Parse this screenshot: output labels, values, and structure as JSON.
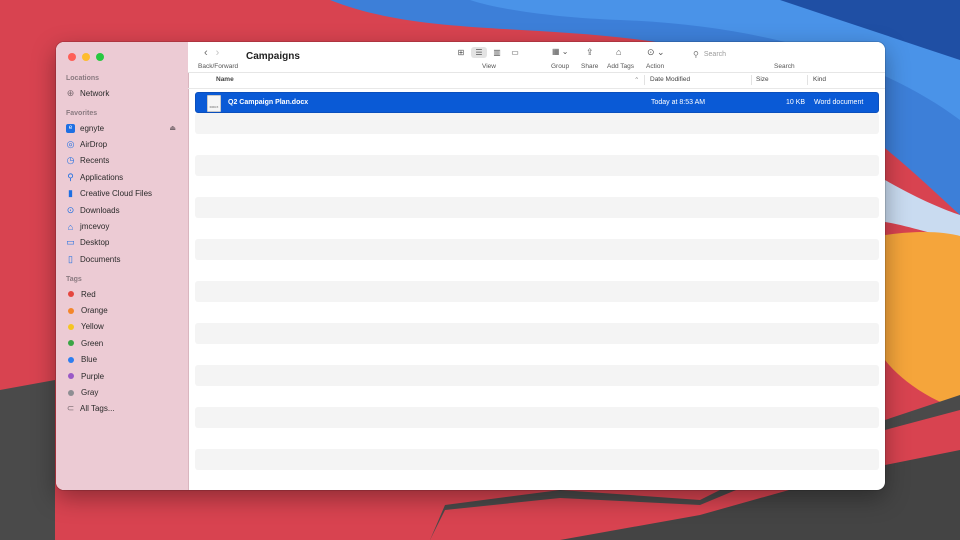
{
  "window": {
    "title": "Campaigns",
    "nav_caption": "Back/Forward"
  },
  "sidebar": {
    "sections": [
      {
        "heading": "Locations",
        "items": [
          {
            "label": "Network",
            "icon": "network-icon"
          }
        ]
      },
      {
        "heading": "Favorites",
        "items": [
          {
            "label": "egnyte",
            "icon": "egnyte-icon"
          },
          {
            "label": "AirDrop",
            "icon": "airdrop-icon"
          },
          {
            "label": "Recents",
            "icon": "clock-icon"
          },
          {
            "label": "Applications",
            "icon": "applications-icon"
          },
          {
            "label": "Creative Cloud Files",
            "icon": "document-icon"
          },
          {
            "label": "Downloads",
            "icon": "download-icon"
          },
          {
            "label": "jmcevoy",
            "icon": "home-icon"
          },
          {
            "label": "Desktop",
            "icon": "desktop-icon"
          },
          {
            "label": "Documents",
            "icon": "document-icon"
          }
        ]
      },
      {
        "heading": "Tags",
        "items": [
          {
            "label": "Red",
            "color": "#e5463f"
          },
          {
            "label": "Orange",
            "color": "#f4862a"
          },
          {
            "label": "Yellow",
            "color": "#f5c522"
          },
          {
            "label": "Green",
            "color": "#3aa545"
          },
          {
            "label": "Blue",
            "color": "#2d7ef0"
          },
          {
            "label": "Purple",
            "color": "#9a59c7"
          },
          {
            "label": "Gray",
            "color": "#8e8e93"
          },
          {
            "label": "All Tags...",
            "icon": "tag-icon"
          }
        ]
      }
    ]
  },
  "toolbar": {
    "view_label": "View",
    "group_label": "Group",
    "share_label": "Share",
    "add_tags_label": "Add Tags",
    "action_label": "Action",
    "search_label": "Search",
    "search_placeholder": "Search"
  },
  "columns": {
    "name": "Name",
    "date_modified": "Date Modified",
    "size": "Size",
    "kind": "Kind"
  },
  "files": [
    {
      "name": "Q2 Campaign Plan.docx",
      "date_modified": "Today at 8:53 AM",
      "size": "10 KB",
      "kind": "Word document",
      "icon_text": "DOCX"
    }
  ],
  "colors": {
    "selection": "#0a5ad6",
    "sidebar_bg": "#eccbd4"
  }
}
